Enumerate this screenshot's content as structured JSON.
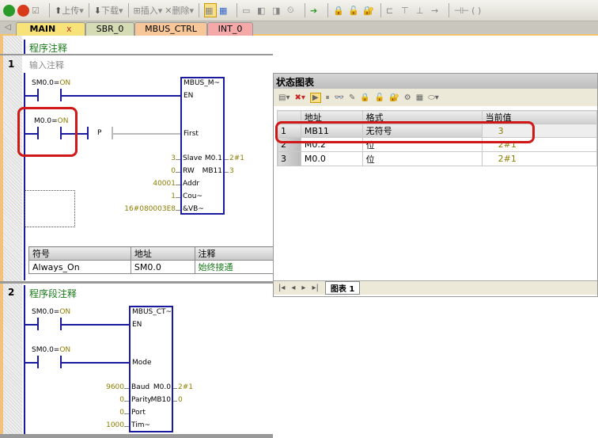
{
  "toolbar": {
    "upload": "上传",
    "download": "下载",
    "insert": "插入",
    "delete": "删除"
  },
  "tabs": [
    {
      "label": "MAIN",
      "close": "x",
      "color": "#f8e27a"
    },
    {
      "label": "SBR_0",
      "color": "#d5dcb5"
    },
    {
      "label": "MBUS_CTRL",
      "color": "#f7c79a"
    },
    {
      "label": "INT_0",
      "color": "#f4a8a8"
    }
  ],
  "program_comment": "程序注释",
  "network1": {
    "number": "1",
    "comment": "输入注释",
    "contact1": {
      "addr": "SM0.0",
      "eq": "=",
      "state": "ON"
    },
    "contact2": {
      "addr": "M0.0",
      "eq": "=",
      "state": "ON"
    },
    "p_label": "P",
    "block": {
      "title": "MBUS_M~",
      "en": "EN",
      "first": "First",
      "inputs": [
        {
          "pin": "Slave",
          "value": "3"
        },
        {
          "pin": "RW",
          "value": "0"
        },
        {
          "pin": "Addr",
          "value": "40001"
        },
        {
          "pin": "Cou~",
          "value": "1"
        },
        {
          "pin": "&VB~",
          "value": "16#080003E8"
        }
      ],
      "outputs": [
        {
          "pin": "M0.1",
          "value": "2#1"
        },
        {
          "pin": "MB11",
          "value": "3"
        }
      ]
    },
    "symbols": {
      "headers": [
        "符号",
        "地址",
        "注释"
      ],
      "rows": [
        [
          "Always_On",
          "SM0.0",
          "始终接通"
        ]
      ]
    }
  },
  "network2": {
    "number": "2",
    "comment": "程序段注释",
    "contact1": {
      "addr": "SM0.0",
      "eq": "=",
      "state": "ON"
    },
    "contact2": {
      "addr": "SM0.0",
      "eq": "=",
      "state": "ON"
    },
    "block": {
      "title": "MBUS_CT~",
      "en": "EN",
      "mode": "Mode",
      "inputs": [
        {
          "pin": "Baud",
          "value": "9600"
        },
        {
          "pin": "Parity",
          "value": "0"
        },
        {
          "pin": "Port",
          "value": "0"
        },
        {
          "pin": "Tim~",
          "value": "1000"
        }
      ],
      "outputs": [
        {
          "pin": "M0.0",
          "value": "2#1"
        },
        {
          "pin": "MB10",
          "value": "0"
        }
      ]
    }
  },
  "status_chart": {
    "title": "状态图表",
    "headers": [
      "",
      "地址",
      "格式",
      "当前值"
    ],
    "rows": [
      [
        "1",
        "MB11",
        "无符号",
        "3"
      ],
      [
        "2",
        "M0.2",
        "位",
        "2#1"
      ],
      [
        "3",
        "M0.0",
        "位",
        "2#1"
      ]
    ],
    "sheet_tab": "图表 1"
  },
  "colors": {
    "wire": "#1a1aa0",
    "highlight": "#d01818",
    "value": "#8b7d00"
  }
}
